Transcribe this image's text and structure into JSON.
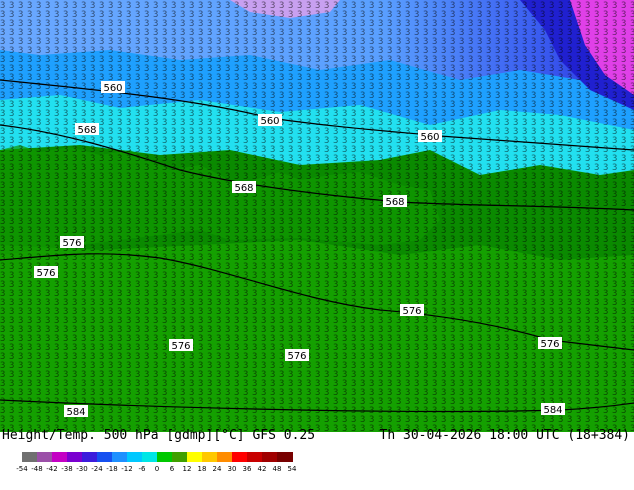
{
  "map": {
    "contour_labels": [
      "560",
      "560",
      "560",
      "568",
      "568",
      "568",
      "576",
      "576",
      "576",
      "576",
      "576",
      "576",
      "584",
      "584"
    ]
  },
  "footer": {
    "left_text": "Height/Temp. 500 hPa [gdmp][°C] GFS 0.25",
    "right_text": "Th 30-04-2026 18:00 UTC (18+384)"
  },
  "colorbar": {
    "ticks": [
      "-54",
      "-48",
      "-42",
      "-38",
      "-30",
      "-24",
      "-18",
      "-12",
      "-6",
      "0",
      "6",
      "12",
      "18",
      "24",
      "30",
      "36",
      "42",
      "48",
      "54"
    ],
    "colors": [
      "#707070",
      "#9b4fa8",
      "#c400c4",
      "#7a00d0",
      "#3c1cdc",
      "#1650f0",
      "#1e90ff",
      "#00c8ff",
      "#00e6e6",
      "#00c800",
      "#40a000",
      "#ffff00",
      "#ffc800",
      "#ff8c00",
      "#ff0000",
      "#c80000",
      "#a00000",
      "#780000"
    ]
  }
}
